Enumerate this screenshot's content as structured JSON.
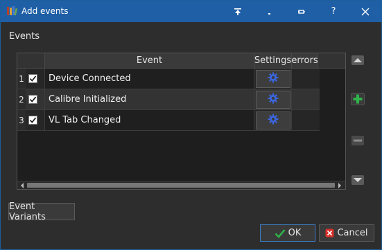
{
  "window": {
    "title": "Add events"
  },
  "titlebar_buttons": [
    {
      "name": "pin-top-icon"
    },
    {
      "name": "minimize-icon"
    },
    {
      "name": "restore-icon"
    },
    {
      "name": "help-icon",
      "label": "?"
    },
    {
      "name": "close-icon"
    }
  ],
  "events_label": "Events",
  "table": {
    "columns": [
      "Event",
      "Settings",
      "errors"
    ],
    "rows": [
      {
        "num": "1",
        "checked": true,
        "event": "Device Connected"
      },
      {
        "num": "2",
        "checked": true,
        "event": "Calibre Initialized"
      },
      {
        "num": "3",
        "checked": true,
        "event": "VL Tab Changed"
      }
    ]
  },
  "side_buttons": [
    "move-up-icon",
    "add-icon",
    "remove-icon",
    "move-down-icon"
  ],
  "buttons": {
    "variants": "Event Variants",
    "ok": "OK",
    "cancel": "Cancel"
  },
  "colors": {
    "titlebar": "#1f5fa6",
    "gear": "#3a66e0",
    "add": "#2fb34a",
    "ok_check": "#2fb34a",
    "cancel_x": "#d9322a"
  }
}
